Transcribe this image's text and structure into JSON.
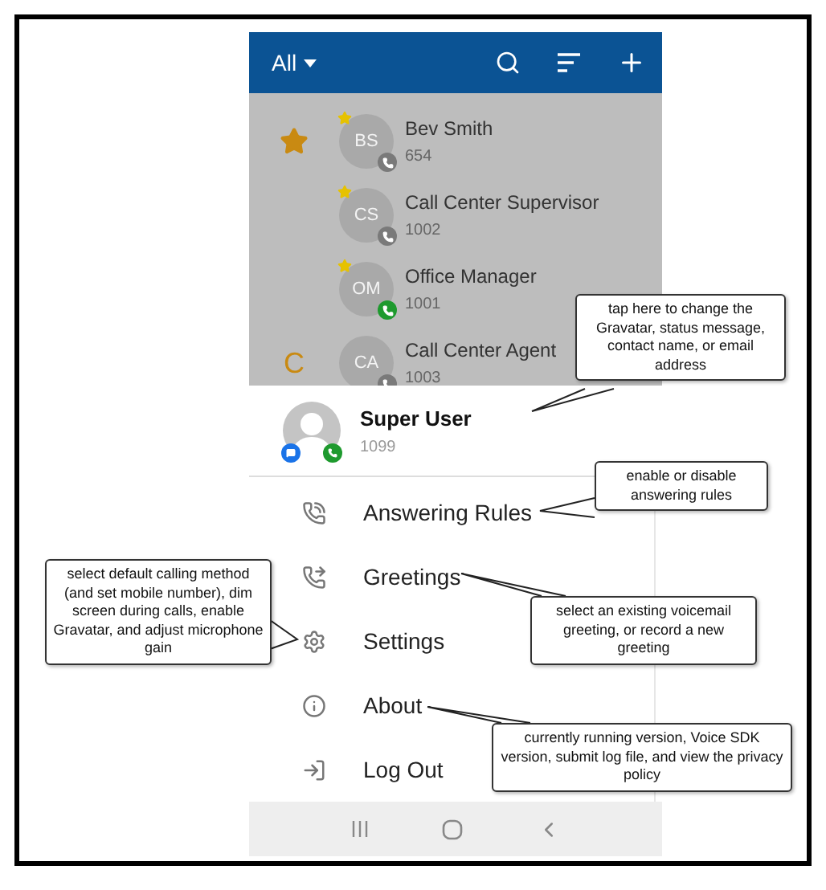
{
  "toolbar": {
    "filter": "All"
  },
  "contact_groups": [
    {
      "kind": "favorites",
      "contacts": [
        {
          "initials": "BS",
          "name": "Bev Smith",
          "extension": "654",
          "favorite": true,
          "color": "#7a7a7a"
        },
        {
          "initials": "CS",
          "name": "Call Center Supervisor",
          "extension": "1002",
          "favorite": true,
          "color": "#7a7a7a"
        },
        {
          "initials": "OM",
          "name": "Office Manager",
          "extension": "1001",
          "favorite": true,
          "color": "#1e9a2e"
        }
      ]
    },
    {
      "kind": "letter",
      "letter": "C",
      "contacts": [
        {
          "initials": "CA",
          "name": "Call Center Agent",
          "extension": "1003",
          "favorite": false,
          "color": "#7a7a7a"
        }
      ]
    }
  ],
  "profile": {
    "name": "Super User",
    "extension": "1099"
  },
  "menu": [
    {
      "label": "Answering Rules"
    },
    {
      "label": "Greetings"
    },
    {
      "label": "Settings"
    },
    {
      "label": "About"
    },
    {
      "label": "Log Out"
    }
  ],
  "callouts": [
    {
      "text": "tap here to change the Gravatar, status message, contact name, or email address"
    },
    {
      "text": "enable or disable answering rules"
    },
    {
      "text": "select default calling method (and set mobile number), dim screen during calls, enable Gravatar, and adjust microphone gain"
    },
    {
      "text": "select an existing voicemail greeting, or record a new greeting"
    },
    {
      "text": "currently running version, Voice SDK version, submit log file, and view the privacy policy"
    }
  ]
}
